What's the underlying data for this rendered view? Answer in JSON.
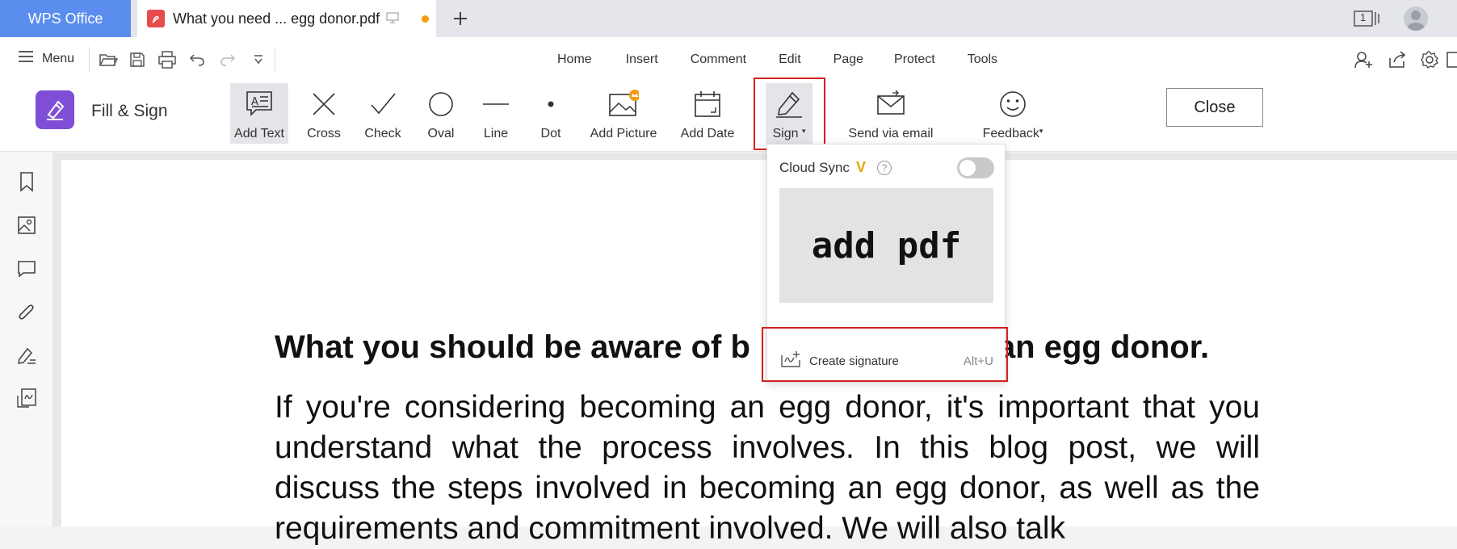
{
  "titlebar": {
    "app_name": "WPS Office",
    "doc_tab": "What you need ... egg donor.pdf",
    "page_count_badge": "1"
  },
  "menubar": {
    "menu_label": "Menu",
    "tabs": [
      "Home",
      "Insert",
      "Comment",
      "Edit",
      "Page",
      "Protect",
      "Tools"
    ]
  },
  "ribbon": {
    "title": "Fill & Sign",
    "tools": {
      "add_text": "Add Text",
      "cross": "Cross",
      "check": "Check",
      "oval": "Oval",
      "line": "Line",
      "dot": "Dot",
      "add_picture": "Add Picture",
      "add_date": "Add Date",
      "sign": "Sign",
      "send_email": "Send via email",
      "feedback": "Feedback"
    },
    "close_label": "Close"
  },
  "sign_popup": {
    "cloud_sync_label": "Cloud Sync",
    "vip_badge": "V",
    "help_glyph": "?",
    "signature_preview": "add pdf",
    "create_label": "Create signature",
    "create_shortcut": "Alt+U"
  },
  "document": {
    "heading_left": "What you should be aware of b",
    "heading_right": "an egg donor.",
    "body": "If you're considering becoming an egg donor, it's important that you understand what the process involves. In this blog post, we will discuss the steps involved in becoming an egg donor, as well as the requirements and commitment involved. We will also talk"
  },
  "colors": {
    "app_tab": "#5b8def",
    "accent_purple": "#7e4fd6",
    "highlight_red": "#d42020",
    "vip_gold": "#e2a800"
  }
}
